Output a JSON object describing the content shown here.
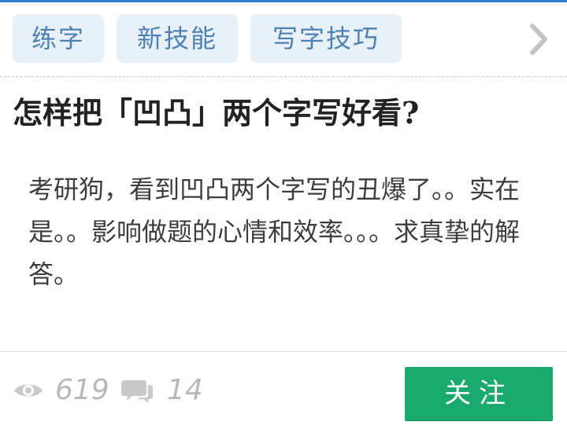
{
  "tags": [
    {
      "label": "练字"
    },
    {
      "label": "新技能"
    },
    {
      "label": "写字技巧"
    }
  ],
  "icons": {
    "more": "chevron-right-icon",
    "views": "eye-icon",
    "comments": "comment-icon"
  },
  "question": {
    "title": "怎样把「凹凸」两个字写好看?",
    "body": "考研狗，看到凹凸两个字写的丑爆了。。实在是。。影响做题的心情和效率。。。求真挚的解答。"
  },
  "stats": {
    "views": "619",
    "comments": "14"
  },
  "actions": {
    "follow_label": "关注"
  },
  "colors": {
    "accent": "#2f7fcf",
    "tag_bg": "#e8f1f8",
    "tag_text": "#4d80b3",
    "follow_bg": "#1aaa6d",
    "stat_text": "#b8b8b8"
  }
}
